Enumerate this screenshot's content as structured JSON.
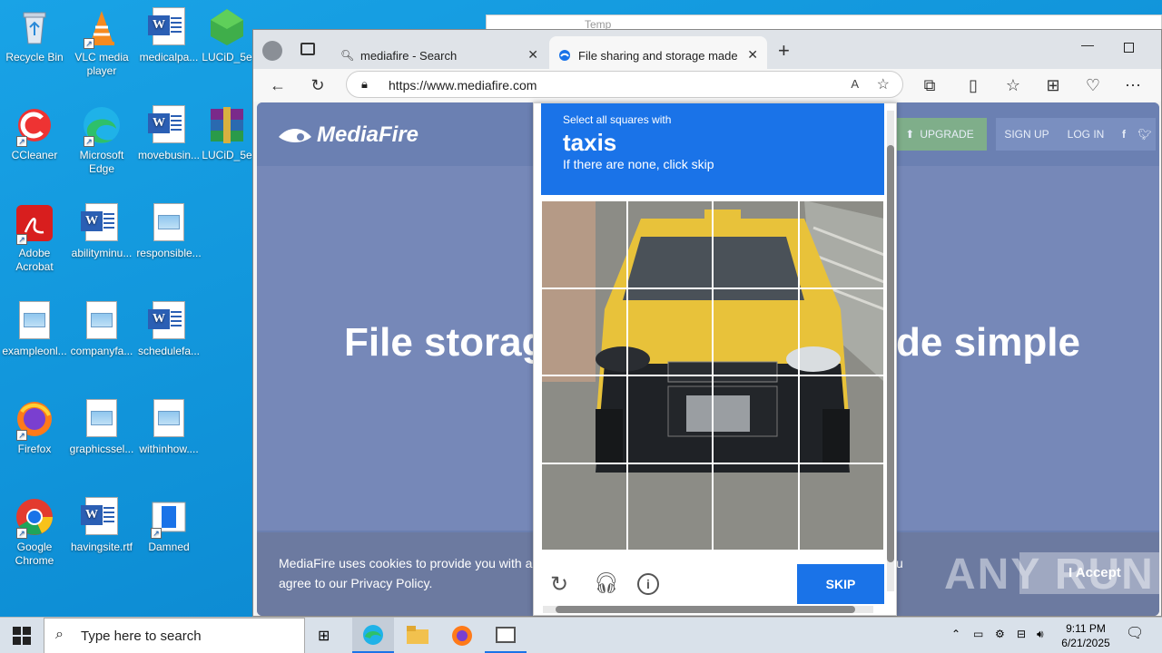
{
  "desktop": {
    "icons": [
      {
        "label": "Recycle Bin"
      },
      {
        "label": "VLC media player"
      },
      {
        "label": "medicalpa..."
      },
      {
        "label": "LUCiD_5e"
      },
      {
        "label": "CCleaner"
      },
      {
        "label": "Microsoft Edge"
      },
      {
        "label": "movebusin..."
      },
      {
        "label": "LUCiD_5e"
      },
      {
        "label": "Adobe Acrobat"
      },
      {
        "label": "abilityminu..."
      },
      {
        "label": "responsible..."
      },
      {
        "label": "exampleonl..."
      },
      {
        "label": "companyfa..."
      },
      {
        "label": "schedulefa..."
      },
      {
        "label": "Firefox"
      },
      {
        "label": "graphicssel..."
      },
      {
        "label": "withinhow...."
      },
      {
        "label": "Google Chrome"
      },
      {
        "label": "havingsite.rtf"
      },
      {
        "label": "Damned"
      }
    ],
    "bg_window_title": "Temp"
  },
  "browser": {
    "tabs": [
      {
        "label": "mediafire - Search"
      },
      {
        "label": "File sharing and storage made sim"
      }
    ],
    "url": "https://www.mediafire.com"
  },
  "mediafire": {
    "logo": "MediaFire",
    "upgrade": "UPGRADE",
    "signup": "SIGN UP",
    "login": "LOG IN",
    "hero_left": "File storag",
    "hero_right": "de simple",
    "cookie_line1": "MediaFire uses cookies to provide you with a p",
    "cookie_line1_tail": "u",
    "cookie_line2": "agree to our Privacy Policy.",
    "accept": "I Accept"
  },
  "captcha": {
    "instruction": "Select all squares with",
    "target": "taxis",
    "hint": "If there are none, click skip",
    "skip": "SKIP"
  },
  "taskbar": {
    "search_placeholder": "Type here to search",
    "time": "9:11 PM",
    "date": "6/21/2025"
  },
  "watermark": "ANY RUN",
  "colors": {
    "accent": "#1a73e8",
    "desktop": "#0e8fd6"
  }
}
